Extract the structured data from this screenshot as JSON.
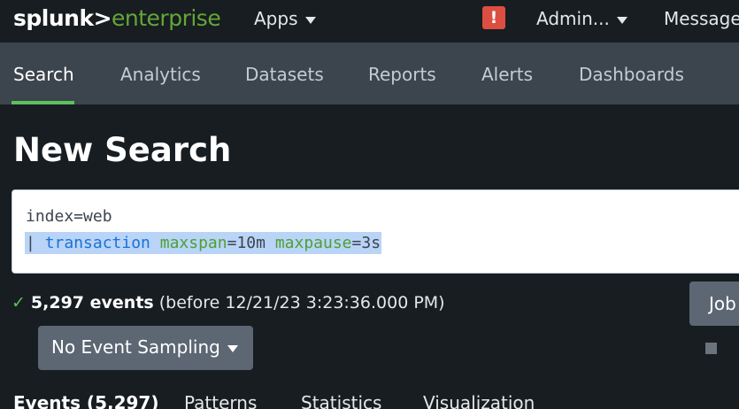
{
  "header": {
    "logo_part1": "splunk>",
    "logo_part2": "enterprise",
    "apps_label": "Apps",
    "alert_glyph": "!",
    "admin_label": "Admin...",
    "messages_label": "Message"
  },
  "app_nav": {
    "tabs": [
      {
        "label": "Search",
        "active": true
      },
      {
        "label": "Analytics"
      },
      {
        "label": "Datasets"
      },
      {
        "label": "Reports"
      },
      {
        "label": "Alerts"
      },
      {
        "label": "Dashboards"
      }
    ]
  },
  "page": {
    "title": "New Search"
  },
  "search": {
    "line1": "index=web",
    "line2_pipe": "| ",
    "line2_command": "transaction",
    "line2_arg1_name": "maxspan",
    "line2_arg1_value": "=10m",
    "line2_arg2_name": "maxpause",
    "line2_arg2_value": "=3s"
  },
  "status": {
    "check_glyph": "✓",
    "event_count": "5,297 events",
    "detail": "(before 12/21/23 3:23:36.000 PM)"
  },
  "job_button": {
    "label": "Job"
  },
  "sampling": {
    "label": "No Event Sampling"
  },
  "result_tabs": [
    {
      "label": "Events (5,297)",
      "active": true
    },
    {
      "label": "Patterns"
    },
    {
      "label": "Statistics"
    },
    {
      "label": "Visualization"
    }
  ],
  "colors": {
    "accent_green": "#65a637",
    "alert_red": "#dc4e41",
    "tab_bar": "#3c444d"
  }
}
